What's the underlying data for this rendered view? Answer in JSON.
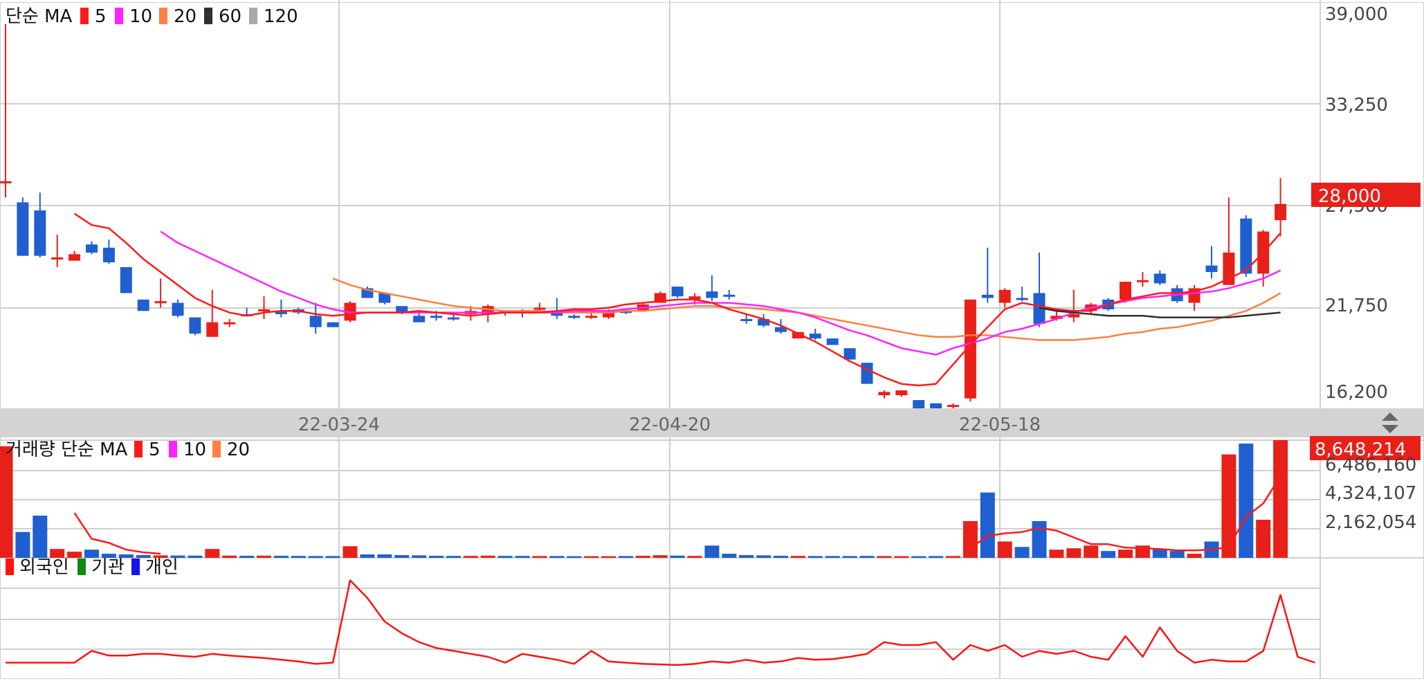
{
  "colors": {
    "up": "#e8201a",
    "down": "#1f5fd0",
    "ma5": "#ff1a1a",
    "ma10": "#ff22ff",
    "ma20": "#ff8040",
    "ma60": "#303030",
    "ma120": "#a9a9a9",
    "foreign": "#ff1111",
    "institution": "#118811",
    "individual": "#1515ee",
    "grid": "#cfcfcf",
    "band": "#d3d3d3"
  },
  "price_panel": {
    "legend_prefix": "단순 MA",
    "legend": [
      {
        "label": "5",
        "color": "#ff1a1a"
      },
      {
        "label": "10",
        "color": "#ff22ff"
      },
      {
        "label": "20",
        "color": "#ff8040"
      },
      {
        "label": "60",
        "color": "#303030"
      },
      {
        "label": "120",
        "color": "#a9a9a9"
      }
    ],
    "y_ticks": [
      "39,000",
      "33,250",
      "27,500",
      "21,750",
      "16,200"
    ],
    "current_price_label": "28,000"
  },
  "date_axis": {
    "labels": [
      "22-03-24",
      "22-04-20",
      "22-05-18"
    ]
  },
  "volume_panel": {
    "legend_prefix": "거래량 단순 MA",
    "legend": [
      {
        "label": "5",
        "color": "#ff1a1a"
      },
      {
        "label": "10",
        "color": "#ff22ff"
      },
      {
        "label": "20",
        "color": "#ff8040"
      }
    ],
    "y_ticks": [
      "6,486,160",
      "4,324,107",
      "2,162,054"
    ],
    "current_volume_label": "8,648,214"
  },
  "investor_panel": {
    "legend": [
      {
        "label": "외국인",
        "color": "#ff1111"
      },
      {
        "label": "기관",
        "color": "#118811"
      },
      {
        "label": "개인",
        "color": "#1515ee"
      }
    ]
  },
  "chart_data": {
    "type": "candlestick",
    "note_dates": [
      "22-03-24",
      "22-04-20",
      "22-05-18"
    ],
    "ylim": [
      16200,
      39000
    ],
    "candles": [
      [
        28800,
        28800,
        38500,
        27800
      ],
      [
        27500,
        24200,
        27800,
        24200
      ],
      [
        27000,
        24200,
        28100,
        24100
      ],
      [
        24100,
        24100,
        25500,
        23500
      ],
      [
        23900,
        24300,
        24500,
        23900
      ],
      [
        24900,
        24400,
        25100,
        24300
      ],
      [
        24700,
        23800,
        25200,
        23700
      ],
      [
        23500,
        21900,
        23500,
        21900
      ],
      [
        21500,
        20800,
        21500,
        20800
      ],
      [
        21400,
        21400,
        22800,
        21000
      ],
      [
        21300,
        20500,
        21500,
        20400
      ],
      [
        20400,
        19400,
        20400,
        19300
      ],
      [
        19200,
        20100,
        22100,
        19200
      ],
      [
        20000,
        20100,
        20300,
        19800
      ],
      [
        20600,
        20500,
        21000,
        20500
      ],
      [
        20900,
        20900,
        21700,
        20300
      ],
      [
        20800,
        20600,
        21500,
        20400
      ],
      [
        20900,
        20700,
        21000,
        20600
      ],
      [
        20500,
        19800,
        21300,
        19400
      ],
      [
        20100,
        19800,
        20100,
        19800
      ],
      [
        20200,
        21300,
        21400,
        20100
      ],
      [
        22200,
        21600,
        22300,
        21600
      ],
      [
        21900,
        21300,
        21900,
        21200
      ],
      [
        21100,
        20700,
        21100,
        20600
      ],
      [
        20500,
        20100,
        20700,
        20100
      ],
      [
        20500,
        20400,
        20800,
        20200
      ],
      [
        20400,
        20300,
        20700,
        20200
      ],
      [
        20600,
        20800,
        21100,
        20200
      ],
      [
        20600,
        21100,
        21200,
        20100
      ],
      [
        20800,
        20700,
        20800,
        20500
      ],
      [
        20800,
        20700,
        20900,
        20400
      ],
      [
        20900,
        21000,
        21300,
        20800
      ],
      [
        20800,
        20500,
        21600,
        20300
      ],
      [
        20500,
        20400,
        20600,
        20300
      ],
      [
        20500,
        20500,
        20700,
        20300
      ],
      [
        20400,
        20800,
        20900,
        20300
      ],
      [
        20800,
        20700,
        20900,
        20600
      ],
      [
        20800,
        21200,
        21300,
        20800
      ],
      [
        21300,
        21900,
        22000,
        21300
      ],
      [
        22300,
        21700,
        22300,
        21600
      ],
      [
        21500,
        21700,
        21900,
        21200
      ],
      [
        22000,
        21600,
        23000,
        21400
      ],
      [
        21800,
        21700,
        22100,
        21500
      ],
      [
        20300,
        20200,
        20600,
        20000
      ],
      [
        20300,
        19900,
        20600,
        19800
      ],
      [
        19800,
        19500,
        20300,
        19400
      ],
      [
        19100,
        19500,
        19500,
        19100
      ],
      [
        19400,
        19100,
        19700,
        19000
      ],
      [
        19100,
        18700,
        19100,
        18700
      ],
      [
        18500,
        17800,
        18500,
        17800
      ],
      [
        17600,
        16300,
        17600,
        16300
      ],
      [
        15600,
        15800,
        15900,
        15400
      ],
      [
        15600,
        15900,
        15900,
        15500
      ],
      [
        15300,
        14500,
        15300,
        14500
      ],
      [
        15100,
        14700,
        15100,
        14600
      ],
      [
        15000,
        15000,
        15100,
        14600
      ],
      [
        15400,
        21500,
        21500,
        15200
      ],
      [
        21800,
        21600,
        24700,
        21300
      ],
      [
        21300,
        22100,
        22200,
        21000
      ],
      [
        21600,
        21500,
        22300,
        21400
      ],
      [
        21900,
        20000,
        24400,
        19800
      ],
      [
        20300,
        20500,
        20800,
        20200
      ],
      [
        20400,
        20600,
        22100,
        20100
      ],
      [
        20800,
        21200,
        21300,
        20600
      ],
      [
        21500,
        20900,
        21600,
        20800
      ],
      [
        21500,
        22600,
        22600,
        21300
      ],
      [
        22700,
        22700,
        23200,
        22300
      ],
      [
        23100,
        22500,
        23300,
        22400
      ],
      [
        22200,
        21400,
        22400,
        21300
      ],
      [
        21300,
        22200,
        22400,
        20800
      ],
      [
        23600,
        23200,
        24800,
        22800
      ],
      [
        22400,
        24400,
        27800,
        23800
      ],
      [
        26500,
        23100,
        26700,
        22900
      ],
      [
        23100,
        25700,
        25800,
        22300
      ],
      [
        26400,
        27400,
        29000,
        25400
      ]
    ],
    "ma5": [
      null,
      null,
      null,
      null,
      26800,
      26100,
      25900,
      25000,
      24000,
      23200,
      22400,
      21600,
      21100,
      20700,
      20500,
      20700,
      20800,
      20800,
      20600,
      20500,
      20600,
      20700,
      20700,
      20700,
      20800,
      20700,
      20600,
      20500,
      20600,
      20700,
      20700,
      20700,
      20800,
      20900,
      20900,
      21000,
      21200,
      21300,
      21400,
      21500,
      21500,
      21300,
      20900,
      20600,
      20300,
      19900,
      19400,
      18900,
      18300,
      17700,
      17200,
      16700,
      16300,
      16200,
      16300,
      17500,
      18700,
      19800,
      20900,
      21300,
      21100,
      20900,
      20800,
      20800,
      21200,
      21500,
      21700,
      21900,
      21900,
      22000,
      22300,
      22800,
      23300,
      24400,
      25600
    ],
    "ma10": [
      null,
      null,
      null,
      null,
      null,
      null,
      null,
      null,
      null,
      25700,
      25000,
      24500,
      24000,
      23500,
      23000,
      22500,
      22000,
      21600,
      21200,
      20900,
      20700,
      20700,
      20700,
      20700,
      20700,
      20700,
      20700,
      20700,
      20700,
      20700,
      20700,
      20700,
      20700,
      20800,
      20800,
      20800,
      20900,
      21000,
      21100,
      21200,
      21300,
      21300,
      21300,
      21200,
      21100,
      20900,
      20700,
      20400,
      20000,
      19600,
      19300,
      18900,
      18500,
      18300,
      18100,
      18500,
      18800,
      19100,
      19500,
      19700,
      20000,
      20300,
      20700,
      21000,
      21200,
      21400,
      21600,
      21700,
      21800,
      21900,
      22000,
      22200,
      22500,
      22800,
      23300
    ],
    "ma20": [
      null,
      null,
      null,
      null,
      null,
      null,
      null,
      null,
      null,
      null,
      null,
      null,
      null,
      null,
      null,
      null,
      null,
      null,
      null,
      22800,
      22400,
      22100,
      21900,
      21700,
      21500,
      21300,
      21100,
      21000,
      20900,
      20800,
      20800,
      20800,
      20700,
      20700,
      20700,
      20700,
      20800,
      20800,
      20900,
      21000,
      21100,
      21100,
      21000,
      21000,
      20900,
      20800,
      20700,
      20500,
      20300,
      20100,
      19900,
      19700,
      19500,
      19300,
      19200,
      19200,
      19300,
      19300,
      19200,
      19100,
      19000,
      19000,
      19000,
      19100,
      19200,
      19400,
      19500,
      19700,
      19800,
      20000,
      20200,
      20500,
      20800,
      21300,
      21900
    ],
    "ma60": [
      null,
      null,
      null,
      null,
      null,
      null,
      null,
      null,
      null,
      null,
      null,
      null,
      null,
      null,
      null,
      null,
      null,
      null,
      null,
      null,
      null,
      null,
      null,
      null,
      null,
      null,
      null,
      null,
      null,
      null,
      null,
      null,
      null,
      null,
      null,
      null,
      null,
      null,
      null,
      null,
      null,
      null,
      null,
      null,
      null,
      null,
      null,
      null,
      null,
      null,
      null,
      null,
      null,
      null,
      null,
      null,
      null,
      null,
      null,
      null,
      21000,
      20800,
      20700,
      20600,
      20500,
      20500,
      20500,
      20400,
      20400,
      20400,
      20400,
      20400,
      20500,
      20600,
      20700
    ],
    "volume_max": 8648214,
    "volume": [
      8200000,
      1900000,
      3100000,
      650000,
      450000,
      600000,
      300000,
      250000,
      200000,
      180000,
      170000,
      160000,
      650000,
      160000,
      150000,
      160000,
      150000,
      140000,
      130000,
      130000,
      850000,
      250000,
      250000,
      200000,
      180000,
      150000,
      140000,
      140000,
      160000,
      140000,
      140000,
      130000,
      130000,
      120000,
      120000,
      120000,
      130000,
      150000,
      190000,
      160000,
      140000,
      900000,
      300000,
      200000,
      180000,
      150000,
      140000,
      130000,
      130000,
      130000,
      140000,
      130000,
      120000,
      120000,
      130000,
      130000,
      2700000,
      4800000,
      1200000,
      800000,
      2700000,
      600000,
      700000,
      900000,
      500000,
      600000,
      900000,
      650000,
      500000,
      300000,
      1200000,
      7600000,
      8400000,
      2800000,
      8648214
    ],
    "volume_ma5": [
      null,
      null,
      null,
      null,
      3300000,
      1400000,
      1100000,
      600000,
      400000,
      300000,
      null,
      null,
      null,
      null,
      null,
      null,
      null,
      null,
      null,
      null,
      null,
      null,
      null,
      null,
      null,
      null,
      null,
      null,
      null,
      null,
      null,
      null,
      null,
      null,
      null,
      null,
      null,
      null,
      null,
      null,
      null,
      null,
      null,
      null,
      null,
      null,
      null,
      null,
      null,
      null,
      null,
      null,
      null,
      null,
      null,
      null,
      700000,
      1600000,
      1800000,
      1900000,
      2200000,
      2000000,
      1500000,
      1000000,
      1000000,
      750000,
      700000,
      650000,
      550000,
      550000,
      600000,
      800000,
      3000000,
      4000000,
      6000000
    ],
    "foreign": [
      10,
      10,
      10,
      10,
      10,
      30,
      22,
      22,
      25,
      25,
      22,
      20,
      25,
      22,
      20,
      18,
      15,
      12,
      8,
      10,
      150,
      120,
      80,
      60,
      45,
      35,
      30,
      25,
      20,
      10,
      25,
      20,
      15,
      8,
      30,
      12,
      10,
      8,
      7,
      6,
      8,
      12,
      10,
      15,
      10,
      12,
      18,
      15,
      16,
      20,
      25,
      45,
      40,
      40,
      45,
      15,
      40,
      30,
      40,
      20,
      30,
      25,
      30,
      20,
      15,
      55,
      20,
      70,
      30,
      10,
      15,
      12,
      12,
      30,
      125,
      20,
      10
    ]
  }
}
